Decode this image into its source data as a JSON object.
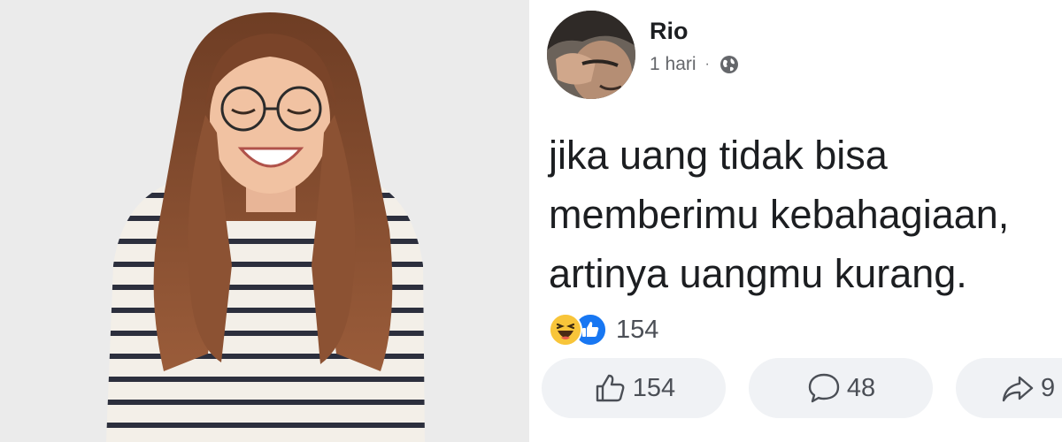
{
  "post": {
    "author": "Rio",
    "time": "1 hari",
    "separator": "·",
    "text": "jika uang tidak bisa\nmemberimu kebahagiaan,\nartinya uangmu kurang.",
    "reaction_count": "154",
    "actions": {
      "like_count": "154",
      "comment_count": "48",
      "share_count": "9"
    }
  },
  "icons": {
    "privacy": "globe-icon",
    "reactions": [
      "haha-icon",
      "like-badge-icon"
    ],
    "like": "thumbs-up-icon",
    "comment": "comment-bubble-icon",
    "share": "share-arrow-icon"
  },
  "colors": {
    "text": "#1c1e21",
    "secondary": "#65676b",
    "button_bg": "#f0f2f5",
    "like_blue": "#1877f2",
    "haha_yellow": "#f8c53a"
  }
}
